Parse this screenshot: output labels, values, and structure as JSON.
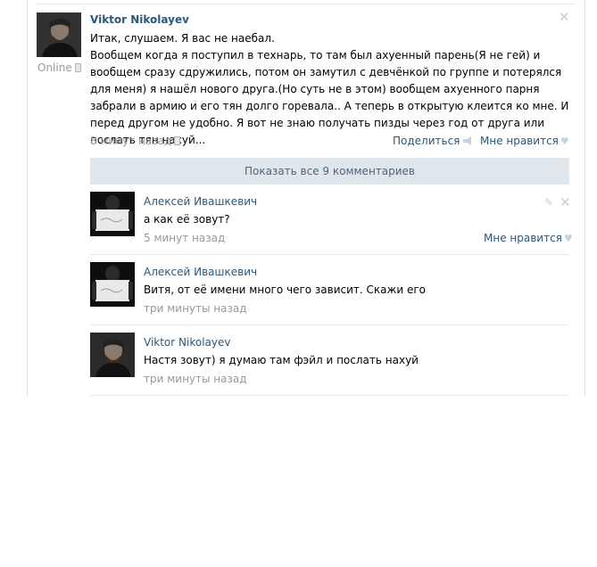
{
  "post": {
    "author": "Viktor Nikolayev",
    "status": "Online",
    "lines": [
      "Итак, слушаем. Я вас не наебал.",
      "Вообщем когда я поступил в технарь, то там был ахуенный парень(Я не гей) и вообщем сразу сдружились, потом он замутил с девчёнкой по группе и потерялся для меня) я нашёл нового друга.(Но суть не в этом) вообщем ахуенного парня забрали в армию и его тян долго горевала.. А теперь в открытую клеится ко мне. И перед другом не удобно. Я вот не знаю получать пизды через год от друга или послать тян нахуй..."
    ],
    "time": "8 минут назад",
    "share_label": "Поделиться",
    "like_label": "Мне нравится"
  },
  "show_all_label": "Показать все 9 комментариев",
  "comments": [
    {
      "author": "Алексей Ивашкевич",
      "text": "а как её зовут?",
      "time": "5 минут назад",
      "like_label": "Мне нравится"
    },
    {
      "author": "Алексей Ивашкевич",
      "text": "Витя, от её имени много чего зависит. Скажи его",
      "time": "три минуты назад"
    },
    {
      "author": "Viktor Nikolayev",
      "text": "Настя зовут) я думаю там фэйл и послать нахуй",
      "time": "три минуты назад"
    }
  ],
  "icons": {
    "close": "close-icon",
    "edit": "pencil-icon",
    "share": "megaphone-icon",
    "like": "heart-icon",
    "mobile": "phone-icon"
  },
  "colors": {
    "link": "#2b587a",
    "muted": "#999999",
    "show_all_bg": "#dfe6ec"
  }
}
